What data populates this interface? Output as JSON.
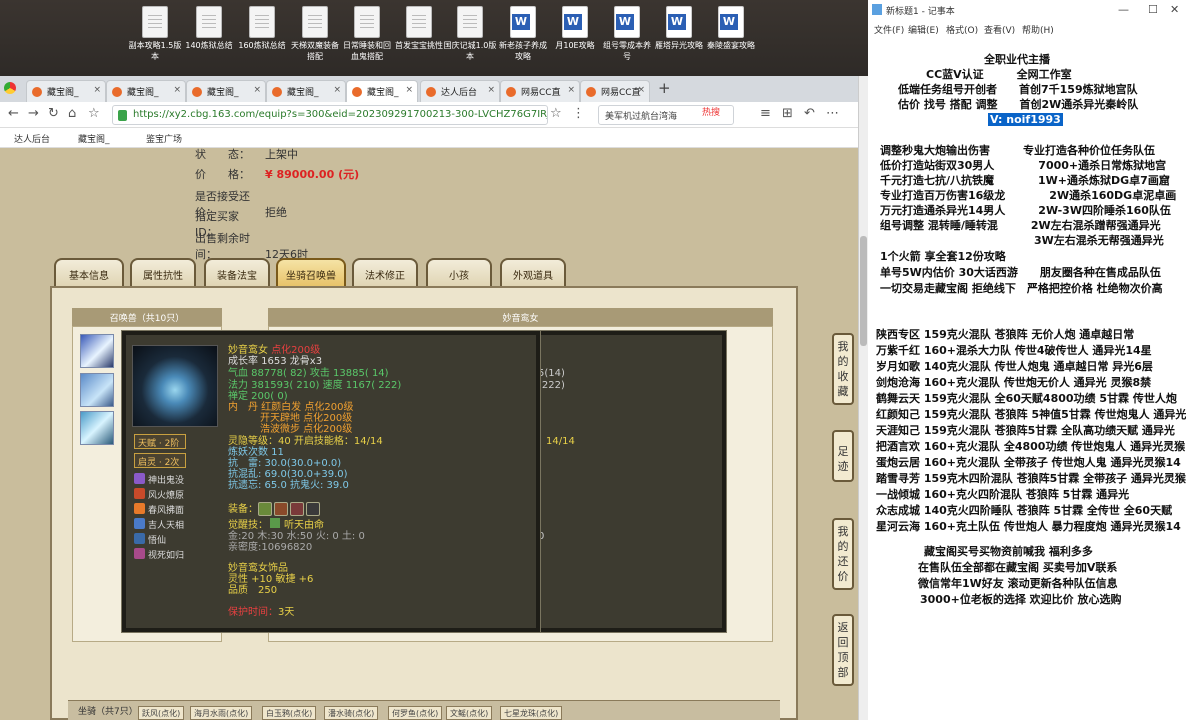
{
  "desktop": {
    "icons": [
      {
        "label": "副本攻略1.5版本",
        "type": "doc"
      },
      {
        "label": "140炼狱总结",
        "type": "doc"
      },
      {
        "label": "160炼狱总结",
        "type": "doc"
      },
      {
        "label": "天梯双魔装备搭配",
        "type": "doc"
      },
      {
        "label": "日常睡装和回血鬼搭配",
        "type": "doc"
      },
      {
        "label": "首发宝宝挑性",
        "type": "doc"
      },
      {
        "label": "国庆记城1.0版本",
        "type": "doc"
      },
      {
        "label": "新老孩子养成攻略",
        "type": "word"
      },
      {
        "label": "月10E攻略",
        "type": "word"
      },
      {
        "label": "组号零成本养号",
        "type": "word"
      },
      {
        "label": "雁塔异光攻略",
        "type": "word"
      },
      {
        "label": "秦陵盛宴攻略",
        "type": "word"
      }
    ]
  },
  "browser": {
    "tabs": [
      {
        "label": "藏宝阁_",
        "close": "×"
      },
      {
        "label": "藏宝阁_",
        "close": "×"
      },
      {
        "label": "藏宝阁_",
        "close": "×"
      },
      {
        "label": "藏宝阁_",
        "close": "×"
      },
      {
        "label": "藏宝阁_",
        "close": "×"
      },
      {
        "label": "达人后台",
        "close": "×"
      },
      {
        "label": "网易CC直",
        "close": "×"
      },
      {
        "label": "网易CC直",
        "close": "×"
      }
    ],
    "new_tab": "+",
    "url": "https://xy2.cbg.163.com/equip?s=300&eid=202309291700213-300-LVCHZ76G7IRJ&o&v",
    "search_text": "美军机过航台湾海",
    "hot_label": "热搜",
    "bookmarks": [
      "达人后台",
      "藏宝阁_",
      "鉴宝广场"
    ]
  },
  "listing": {
    "status_label": "状　　态：",
    "status_value": "上架中",
    "price_label": "价　　格：",
    "price_value": "¥ 89000.00 (元)",
    "bargain_label": "是否接受还价：",
    "bargain_value": "拒绝",
    "buyer_label": "指定买家 ID：",
    "buyer_value": "",
    "remain_label": "出售剩余时间：",
    "remain_value": "12天6时"
  },
  "page_tabs": [
    "基本信息",
    "属性抗性",
    "装备法宝",
    "坐骑召唤兽",
    "法术修正",
    "小孩",
    "外观道具"
  ],
  "active_tab": "坐骑召唤兽",
  "summons": {
    "left_header": "召唤兽（共10只）",
    "right_header": "妙音鸾女",
    "ghost_values": [
      "5(14)",
      "(222)",
      "14/14",
      "0"
    ]
  },
  "tooltip": {
    "name": "妙音鸾女",
    "name_suffix": "点化200级",
    "growth": "成长率 1653 龙骨x3",
    "hp": "气血 88778( 82) 攻击 13885( 14)",
    "mp": "法力 381593( 210) 速度 1167( 222)",
    "zen": "禅定 200( 0)",
    "dan1": "内　丹  红颜白发 点化200级",
    "dan2": "开天辟地 点化200级",
    "dan3": "浩波微步 点化200级",
    "spirit": "灵隐等级：40 开启技能格：14/14",
    "refine": "炼妖次数 11",
    "res1": "抗　雷: 30.0(30.0+0.0)",
    "res2": "抗混乱: 69.0(30.0+39.0)",
    "res3": "抗遗忘: 65.0 抗鬼火: 39.0",
    "badge1": "天赋 · 2阶",
    "badge2": "启灵 · 2次",
    "skills": [
      "神出鬼没",
      "风火燎原",
      "春风拂面",
      "吉人天相",
      "悟仙",
      "视死如归"
    ],
    "equip_label": "装备：",
    "awaken_label": "觉醒技：",
    "awaken_value": "听天由命",
    "elements": "金:20 木:30 水:50 火: 0 土: 0",
    "intimacy": "亲密度:10696820",
    "deco_title": "妙音鸾女饰品",
    "deco_stats": "灵性 +10 敏捷 +6",
    "quality": "品质　250",
    "protect_label": "保护时间：",
    "protect_value": "3天"
  },
  "bottom": {
    "label": "坐骑（共7只）",
    "tabs": [
      "跃风(点化)",
      "海月水雨(点化)",
      "白玉鸦(点化)",
      "潘水骑(点化)",
      "何罗鱼(点化)",
      "文鳐(点化)",
      "七星龙珠(点化)"
    ]
  },
  "side_buttons": [
    [
      "我",
      "的",
      "收",
      "藏"
    ],
    [
      "足",
      "迹"
    ],
    [
      "我",
      "的",
      "还",
      "价"
    ],
    [
      "返",
      "回",
      "顶",
      "部"
    ]
  ],
  "notepad": {
    "title": "新标题1 - 记事本",
    "menu": [
      "文件(F)",
      "编辑(E)",
      "格式(O)",
      "查看(V)",
      "帮助(H)"
    ],
    "lines": [
      "全职业代主播",
      "CC蓝V认证　　　全网工作室",
      "低端任务组号开创者　　首创7千159炼狱地宫队",
      "估价 找号 搭配 调整　　首创2W通杀异光秦岭队",
      "V:  noif1993",
      "调整秒鬼大炮输出伤害　　　专业打造各种价位任务队伍",
      "低价打造站街双30男人　　　　7000+通杀日常炼狱地宫",
      "千元打造七抗/八抗铁魔　　　　1W+通杀炼狱DG卓7画窟",
      "专业打造百万伤害16级龙　　　　2W通杀160DG卓泥卓画",
      "万元打造通杀异光14男人　　　2W-3W四阶睡杀160队伍",
      "组号调整 混转睡/睡转混　　　2W左右混杀蹭帮强通异光",
      "　　　　　　　　　　　　　　3W左右混杀无帮强通异光",
      "1个火箭 享全套12份攻略",
      "单号5W内估价 30大话西游　　朋友圈各种在售成品队伍",
      "一切交易走藏宝阁 拒绝线下　严格把控价格 杜绝物次价高",
      "陕西专区 159克火混队 苍狼阵 无价人炮 通卓越日常",
      "万紫千红 160+混杀大力队 传世4破传世人 通异光14星",
      "岁月如歌 140克火混队 传世人炮鬼 通卓越日常 异光6层",
      "剑炮沧海 160+克火混队 传世炮无价人 通异光 灵猴8禁",
      "鹤舞云天 159克火混队 全60天赋4800功绩 5甘霖 传世人炮",
      "红颜知己 159克火混队 苍狼阵 5神值5甘霖 传世炮鬼人 通异光",
      "天涯知己 159克火混队 苍狼阵5甘霖 全队高功绩天赋 通异光",
      "把酒言欢 160+克火混队 全4800功绩 传世炮鬼人 通异光灵猴",
      "蛋炮云居 160+克火混队 全带孩子 传世炮人鬼 通异光灵猴14",
      "踏雪寻芳 159克木四阶混队 苍狼阵5甘霖 全带孩子 通异光灵猴",
      "一战倾城 160+克火四阶混队 苍狼阵 5甘霖 通异光",
      "众志成城 140克火四阶睡队 苍狼阵 5甘霖 全传世 全60天赋",
      "星河云海 160+克土队伍 传世炮人 暴力程度炮 通异光灵猴14",
      "藏宝阁买号买物资前喊我 福利多多",
      "在售队伍全部都在藏宝阁 买卖号加V联系",
      "微信常年1W好友 滚动更新各种队伍信息",
      "3000+位老板的选择 欢迎比价 放心选购"
    ]
  }
}
